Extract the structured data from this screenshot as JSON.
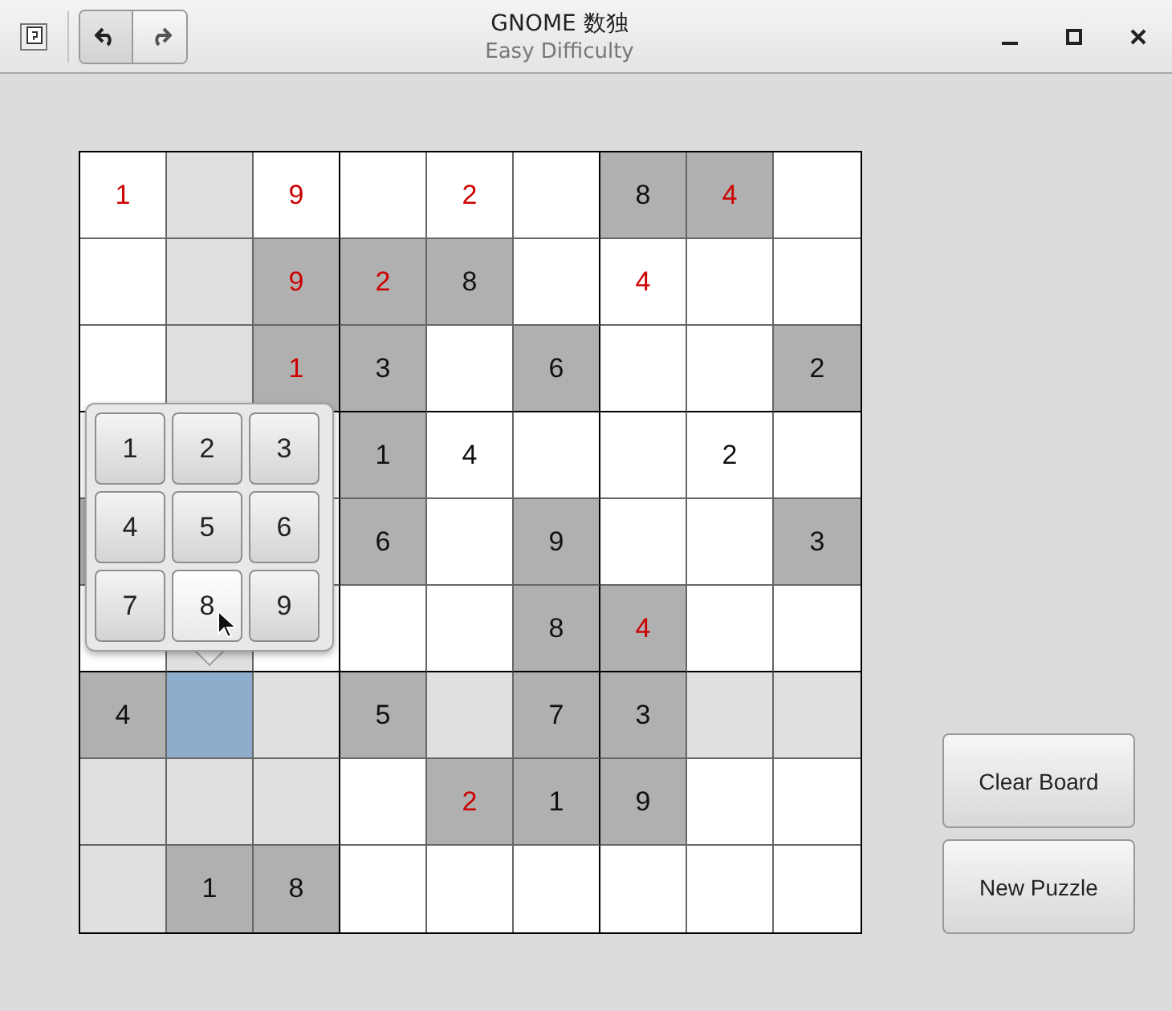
{
  "window": {
    "title": "GNOME 数独",
    "subtitle": "Easy Difficulty"
  },
  "board": {
    "rows": [
      [
        {
          "kind": "normal",
          "value": "1",
          "error": true
        },
        {
          "kind": "highlight"
        },
        {
          "kind": "normal",
          "value": "9",
          "error": true
        },
        {
          "kind": "normal"
        },
        {
          "kind": "normal",
          "value": "2",
          "error": true
        },
        {
          "kind": "normal"
        },
        {
          "kind": "fixed",
          "value": "8",
          "error": false
        },
        {
          "kind": "fixed",
          "value": "4",
          "error": true
        },
        {
          "kind": "normal"
        }
      ],
      [
        {
          "kind": "normal"
        },
        {
          "kind": "highlight"
        },
        {
          "kind": "fixed",
          "value": "9",
          "error": true
        },
        {
          "kind": "fixed",
          "value": "2",
          "error": true
        },
        {
          "kind": "fixed",
          "value": "8",
          "error": false
        },
        {
          "kind": "normal"
        },
        {
          "kind": "normal",
          "value": "4",
          "error": true
        },
        {
          "kind": "normal"
        },
        {
          "kind": "normal"
        }
      ],
      [
        {
          "kind": "normal"
        },
        {
          "kind": "highlight"
        },
        {
          "kind": "fixed",
          "value": "1",
          "error": true
        },
        {
          "kind": "fixed",
          "value": "3",
          "error": false
        },
        {
          "kind": "normal"
        },
        {
          "kind": "fixed",
          "value": "6",
          "error": false
        },
        {
          "kind": "normal"
        },
        {
          "kind": "normal"
        },
        {
          "kind": "fixed",
          "value": "2",
          "error": false
        }
      ],
      [
        {
          "kind": "normal"
        },
        null,
        {
          "kind": "normal"
        },
        {
          "kind": "fixed",
          "value": "1",
          "error": false
        },
        {
          "kind": "normal",
          "value": "4",
          "error": false
        },
        {
          "kind": "normal"
        },
        {
          "kind": "normal"
        },
        {
          "kind": "normal",
          "value": "2",
          "error": false
        },
        {
          "kind": "normal"
        }
      ],
      [
        {
          "kind": "fixed"
        },
        null,
        {
          "kind": "normal"
        },
        {
          "kind": "fixed",
          "value": "6",
          "error": false
        },
        {
          "kind": "normal"
        },
        {
          "kind": "fixed",
          "value": "9",
          "error": false
        },
        {
          "kind": "normal"
        },
        {
          "kind": "normal"
        },
        {
          "kind": "fixed",
          "value": "3",
          "error": false
        }
      ],
      [
        {
          "kind": "normal"
        },
        {
          "kind": "highlight"
        },
        {
          "kind": "normal"
        },
        {
          "kind": "normal"
        },
        {
          "kind": "normal"
        },
        {
          "kind": "fixed",
          "value": "8",
          "error": false
        },
        {
          "kind": "fixed",
          "value": "4",
          "error": true
        },
        {
          "kind": "normal"
        },
        {
          "kind": "normal"
        }
      ],
      [
        {
          "kind": "fixed",
          "value": "4",
          "error": false
        },
        {
          "kind": "selected"
        },
        {
          "kind": "highlight"
        },
        {
          "kind": "fixed",
          "value": "5",
          "error": false
        },
        {
          "kind": "highlight"
        },
        {
          "kind": "fixed",
          "value": "7",
          "error": false
        },
        {
          "kind": "fixed",
          "value": "3",
          "error": false
        },
        {
          "kind": "highlight"
        },
        {
          "kind": "highlight"
        }
      ],
      [
        {
          "kind": "highlight"
        },
        {
          "kind": "highlight"
        },
        {
          "kind": "highlight"
        },
        {
          "kind": "normal"
        },
        {
          "kind": "fixed",
          "value": "2",
          "error": true
        },
        {
          "kind": "fixed",
          "value": "1",
          "error": false
        },
        {
          "kind": "fixed",
          "value": "9",
          "error": false
        },
        {
          "kind": "normal"
        },
        {
          "kind": "normal"
        }
      ],
      [
        {
          "kind": "highlight"
        },
        {
          "kind": "fixed",
          "value": "1",
          "error": false
        },
        {
          "kind": "fixed",
          "value": "8",
          "error": false
        },
        {
          "kind": "normal"
        },
        {
          "kind": "normal"
        },
        {
          "kind": "normal"
        },
        {
          "kind": "normal"
        },
        {
          "kind": "normal"
        },
        {
          "kind": "normal"
        }
      ]
    ]
  },
  "number_picker": {
    "buttons": [
      {
        "label": "1",
        "hovered": false
      },
      {
        "label": "2",
        "hovered": false
      },
      {
        "label": "3",
        "hovered": false
      },
      {
        "label": "4",
        "hovered": false
      },
      {
        "label": "5",
        "hovered": false
      },
      {
        "label": "6",
        "hovered": false
      },
      {
        "label": "7",
        "hovered": false
      },
      {
        "label": "8",
        "hovered": true
      },
      {
        "label": "9",
        "hovered": false
      }
    ]
  },
  "actions": [
    "Clear Board",
    "New Puzzle"
  ]
}
